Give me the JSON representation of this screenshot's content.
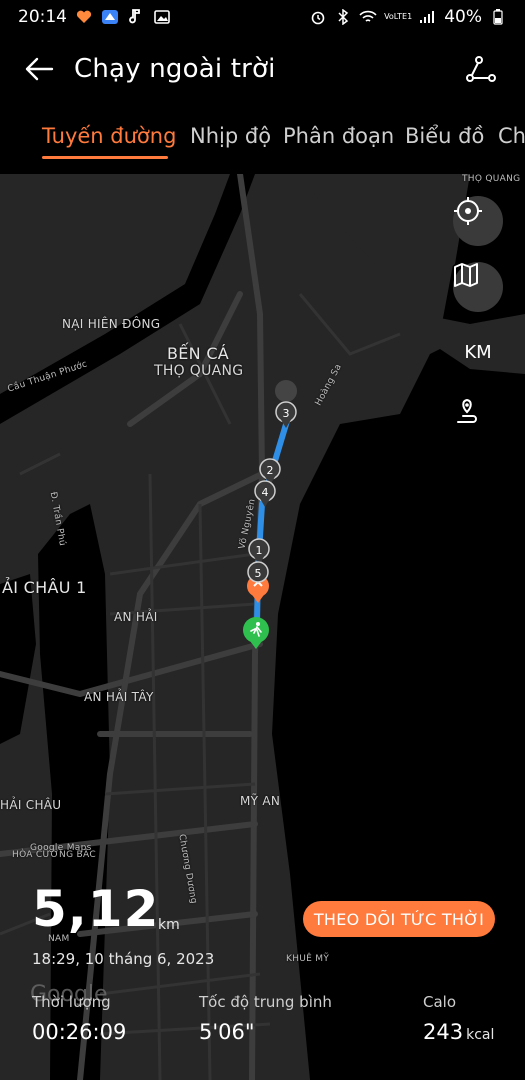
{
  "status_bar": {
    "time": "20:14",
    "network": "VoLTE1",
    "battery": "40%"
  },
  "header": {
    "title": "Chạy ngoài trời",
    "back_icon": "back-arrow-icon",
    "route_icon": "route-share-icon"
  },
  "tabs": [
    {
      "label": "Tuyến đường",
      "active": true
    },
    {
      "label": "Nhịp độ",
      "active": false
    },
    {
      "label": "Phân đoạn",
      "active": false
    },
    {
      "label": "Biểu đồ",
      "active": false
    },
    {
      "label": "Ch",
      "active": false
    }
  ],
  "map": {
    "labels": {
      "tho_quang_top": "THỌ QUANG",
      "nai_hien_dong": "NẠI HIÊN ĐÔNG",
      "ben_ca_1": "BẾN CÁ",
      "ben_ca_2": "THỌ QUANG",
      "cau_thuan_phuoc": "Cầu Thuận Phước",
      "hoang_sa": "Hoàng Sa",
      "tran_phu": "Đ. Trần Phú",
      "vo_nguyen": "Võ Nguyên",
      "hai_chau_1": "ẢI CHÂU 1",
      "an_hai": "AN HẢI",
      "an_hai_tay": "AN HẢI TÂY",
      "hai_chau": "HẢI CHÂU",
      "my_an": "MỸ AN",
      "hoa_cuong": "HÒA CƯỜNG BẮC",
      "nam": "NAM",
      "khue_my": "KHUÊ MỸ",
      "google_maps": "Google Maps",
      "chuong_duong": "Chương Dương"
    },
    "km_markers": [
      "3",
      "2",
      "4",
      "1",
      "5"
    ],
    "controls": {
      "locate_icon": "locate-target-icon",
      "map_type_icon": "map-layers-icon",
      "unit_label": "KM",
      "route_pin_icon": "route-pin-icon"
    }
  },
  "summary": {
    "distance": "5,12",
    "distance_unit": "km",
    "date": "18:29, 10 tháng 6, 2023",
    "live_button": "THEO DÕI TỨC THỜI",
    "google_watermark": "Google",
    "metrics": [
      {
        "label": "Thời lượng",
        "value": "00:26:09",
        "unit": ""
      },
      {
        "label": "Tốc độ trung bình",
        "value": "5'06\"",
        "unit": ""
      },
      {
        "label": "Calo",
        "value": "243",
        "unit": "kcal"
      }
    ]
  },
  "colors": {
    "accent": "#ff7a3d",
    "route": "#2f8fe6",
    "start_marker": "#2fbf4f",
    "map_water": "#000000",
    "map_land": "#262626",
    "map_road": "#3b3b3b"
  }
}
